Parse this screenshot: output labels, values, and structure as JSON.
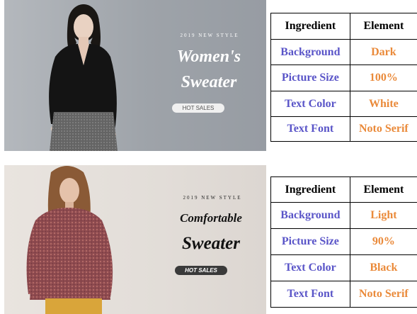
{
  "banners": [
    {
      "overline": "2019 NEW STYLE",
      "title_line1": "Women's",
      "title_line2": "Sweater",
      "badge": "HOT SALES",
      "colors": {
        "text": "#ffffff",
        "badge_bg": "#f0f0f0",
        "badge_text": "#555555"
      }
    },
    {
      "overline": "2019 NEW STYLE",
      "title_line1": "Comfortable",
      "title_line2": "Sweater",
      "badge": "HOT SALES",
      "colors": {
        "text": "#111111",
        "badge_bg": "#3a3a3a",
        "badge_text": "#ffffff"
      }
    }
  ],
  "tables": [
    {
      "header": {
        "col1": "Ingredient",
        "col2": "Element"
      },
      "rows": [
        {
          "ingredient": "Background",
          "element": "Dark"
        },
        {
          "ingredient": "Picture Size",
          "element": "100%"
        },
        {
          "ingredient": "Text Color",
          "element": "White"
        },
        {
          "ingredient": "Text Font",
          "element": "Noto Serif"
        }
      ]
    },
    {
      "header": {
        "col1": "Ingredient",
        "col2": "Element"
      },
      "rows": [
        {
          "ingredient": "Background",
          "element": "Light"
        },
        {
          "ingredient": "Picture Size",
          "element": "90%"
        },
        {
          "ingredient": "Text Color",
          "element": "Black"
        },
        {
          "ingredient": "Text Font",
          "element": "Noto Serif"
        }
      ]
    }
  ],
  "colors": {
    "ingredient": "#5a55c8",
    "element": "#ea8a3a"
  }
}
